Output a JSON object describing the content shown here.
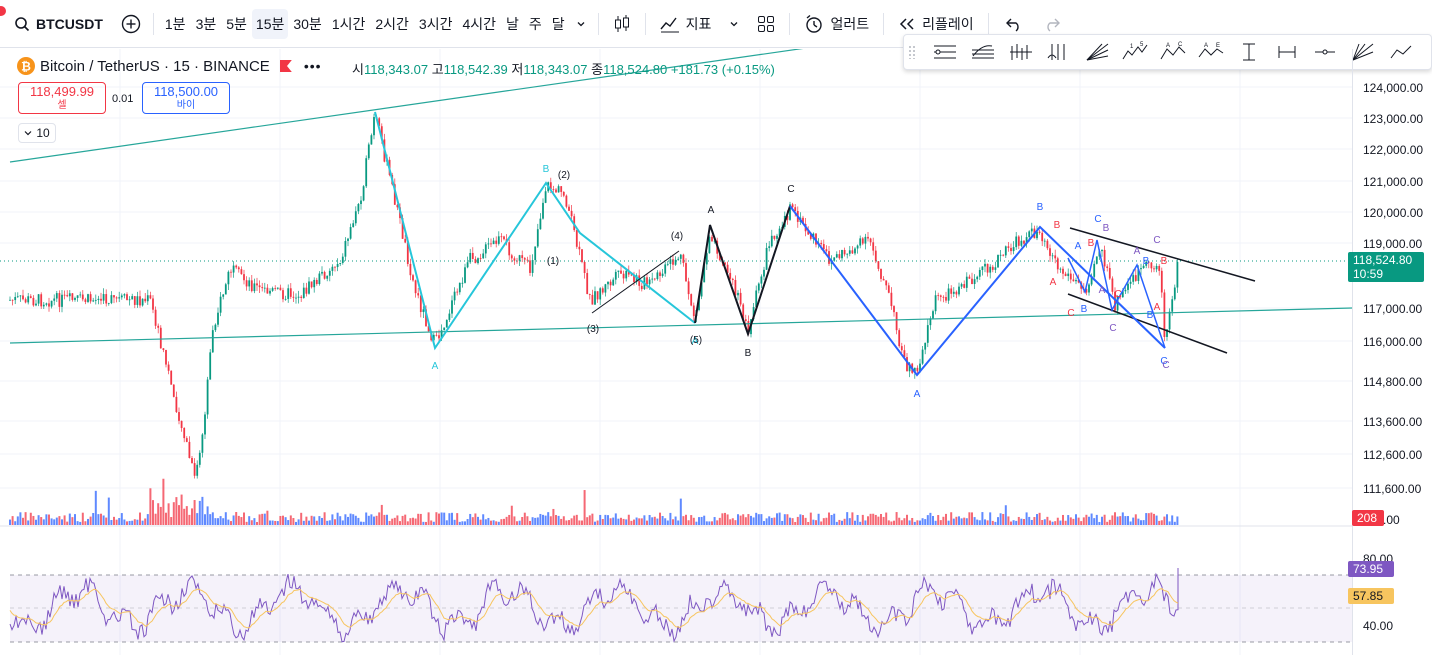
{
  "toolbar": {
    "symbol": "BTCUSDT",
    "intervals": [
      "1분",
      "3분",
      "5분",
      "15분",
      "30분",
      "1시간",
      "2시간",
      "3시간",
      "4시간",
      "날",
      "주",
      "달"
    ],
    "active_interval": "15분",
    "indicators_label": "지표",
    "alert_label": "얼러트",
    "replay_label": "리플레이"
  },
  "legend": {
    "title": "Bitcoin / TetherUS · 15 · BINANCE",
    "open_key": "시",
    "open": "118,343.07",
    "high_key": "고",
    "high": "118,542.39",
    "low_key": "저",
    "low": "118,343.07",
    "close_key": "종",
    "close": "118,524.80",
    "change": "+181.73 (+0.15%)"
  },
  "trade": {
    "sell_price": "118,499.99",
    "sell_label": "셀",
    "spread": "0.01",
    "buy_price": "118,500.00",
    "buy_label": "바이"
  },
  "indicator_count": "10",
  "price_axis": {
    "labels": [
      "124,000.00",
      "123,000.00",
      "122,000.00",
      "121,000.00",
      "120,000.00",
      "119,000.00",
      "117,000.00",
      "116,000.00",
      "114,800.00",
      "113,600.00",
      "112,600.00",
      "111,600.00",
      "700.00"
    ],
    "current_price": "118,524.80",
    "countdown": "10:59",
    "volume_tag": "208"
  },
  "rsi_axis": {
    "labels": [
      "80.00",
      "40.00"
    ],
    "rsi_value": "73.95",
    "ma_value": "57.85"
  },
  "wave_labels": {
    "cyan_A1": "A",
    "cyan_B": "B",
    "cyan_A2": "A",
    "w1": "(1)",
    "w2": "(2)",
    "w3": "(3)",
    "w4": "(4)",
    "w5": "(5)",
    "black_A": "A",
    "black_B": "B",
    "black_C": "C",
    "blue_A": "A",
    "blue_B": "B",
    "r_A": "A",
    "r_B": "B",
    "r_C": "C",
    "r_B2": "B",
    "r_C2": "C",
    "r_A2": "A",
    "r_B3": "B",
    "b_A": "A",
    "b_B": "B",
    "b_C": "C",
    "b_B2": "B",
    "b_C2": "C",
    "b_A2": "A",
    "b_B3": "B",
    "b_C3": "C",
    "p_B": "B",
    "p_C": "C",
    "p_A": "A",
    "p_C2": "C"
  },
  "colors": {
    "up": "#089981",
    "down": "#f23645",
    "cyan_wave": "#26c6da",
    "blue_wave": "#2962ff",
    "trendline": "#26a69a",
    "rsi": "#7e57c2",
    "rsi_ma": "#f7c55f",
    "price_tag": "#089981"
  }
}
